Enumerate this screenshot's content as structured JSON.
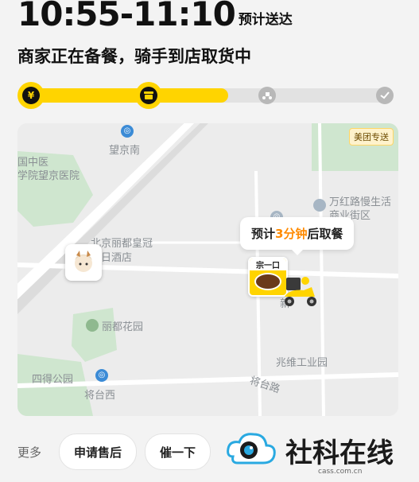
{
  "header": {
    "time_range": "10:55-11:10",
    "time_suffix": "预计送达",
    "status": "商家正在备餐，骑手到店取货中"
  },
  "progress": {
    "level": 0.55,
    "steps": [
      {
        "icon": "yuan-icon",
        "state": "done"
      },
      {
        "icon": "shop-icon",
        "state": "current"
      },
      {
        "icon": "rider-icon",
        "state": "pending"
      },
      {
        "icon": "check-icon",
        "state": "pending"
      }
    ]
  },
  "map": {
    "badge": "美团专送",
    "labels": {
      "wangjing_south": "望京南",
      "hospital_1": "国中医",
      "hospital_2": "学院望京医院",
      "wanhong": "万红路慢生活",
      "wanhong_2": "商业街区",
      "lidu_hotel_1": "北京丽都皇冠",
      "lidu_hotel_2": "日酒店",
      "lidu_garden": "丽都花园",
      "zhaowei": "兆维工业园",
      "sidegongyuan": "四得公园",
      "jiangtai_west": "将台西",
      "jiangtai_road": "将台路",
      "xin": "新"
    },
    "callout": {
      "prefix": "预计",
      "highlight": "3分钟",
      "suffix": "后取餐"
    },
    "shop_name": "宗一口"
  },
  "bottom": {
    "more_label": "更多",
    "after_sale_button": "申请售后",
    "urge_button": "催一下"
  },
  "watermark": {
    "brand": "社科在线",
    "url": "cass.com.cn"
  },
  "colors": {
    "accent": "#ffd400",
    "highlight": "#ff8a00",
    "metro": "#3b8bd6",
    "park": "#cfe6cf"
  }
}
